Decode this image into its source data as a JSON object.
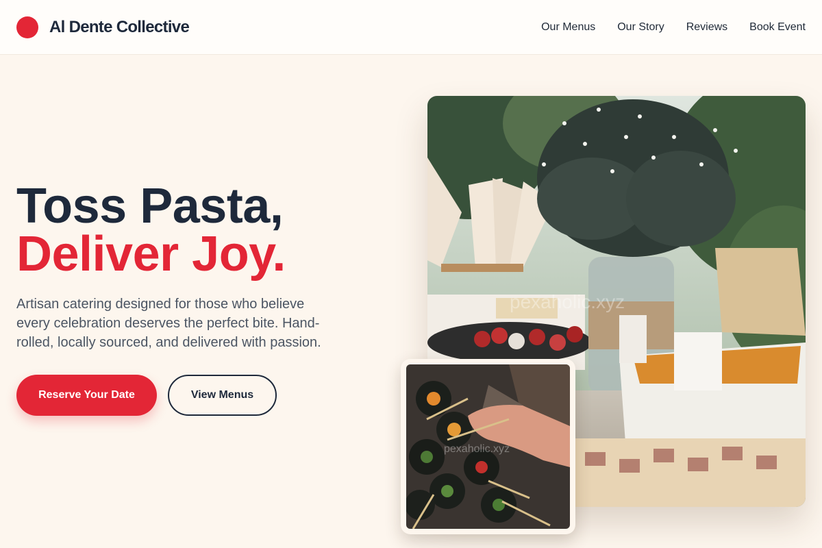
{
  "header": {
    "brand_name": "Al Dente Collective",
    "nav": [
      "Our Menus",
      "Our Story",
      "Reviews",
      "Book Event"
    ]
  },
  "hero": {
    "title_line1": "Toss Pasta,",
    "title_line2": "Deliver Joy.",
    "subtitle": "Artisan catering designed for those who believe every celebration deserves the perfect bite. Hand-rolled, locally sourced, and delivered with passion.",
    "primary_cta": "Reserve Your Date",
    "secondary_cta": "View Menus"
  },
  "images": {
    "watermark": "pexaholic.xyz"
  },
  "colors": {
    "accent": "#e32636",
    "dark": "#1e293b",
    "background": "#fdf6ee"
  }
}
